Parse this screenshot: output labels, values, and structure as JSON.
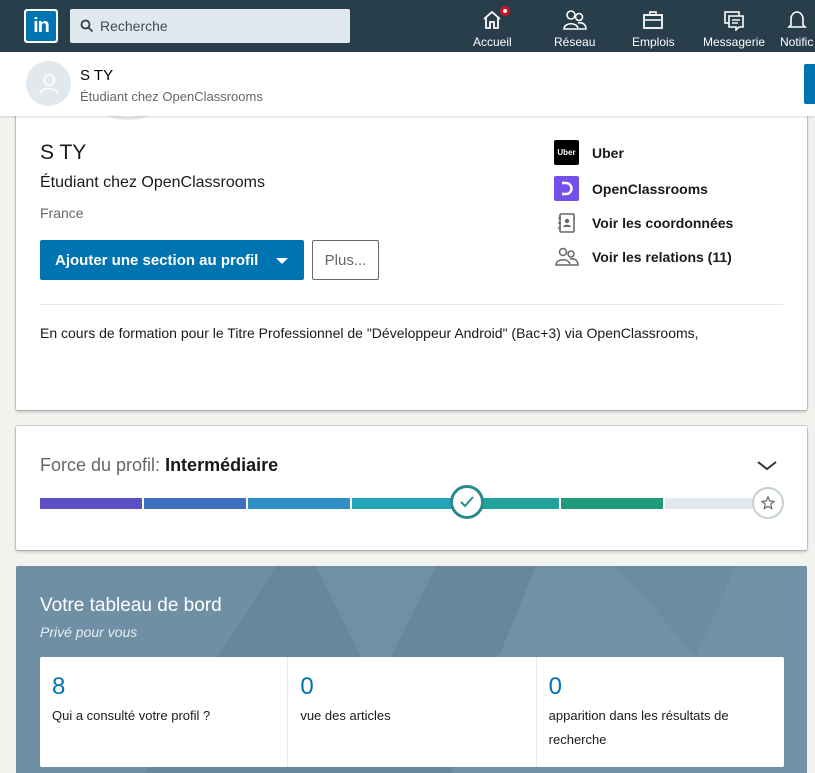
{
  "nav": {
    "logo_text": "in",
    "search_placeholder": "Recherche",
    "items": [
      {
        "label": "Accueil",
        "icon": "home-icon",
        "has_badge": true
      },
      {
        "label": "Réseau",
        "icon": "network-icon"
      },
      {
        "label": "Emplois",
        "icon": "briefcase-icon"
      },
      {
        "label": "Messagerie",
        "icon": "messaging-icon"
      },
      {
        "label": "Notific",
        "icon": "bell-icon"
      }
    ]
  },
  "sticky": {
    "name": "S TY",
    "headline": "Étudiant chez OpenClassrooms"
  },
  "profile": {
    "name": "S TY",
    "headline": "Étudiant chez OpenClassrooms",
    "location": "France",
    "add_section_label": "Ajouter une section au profil",
    "more_label": "Plus...",
    "right": {
      "company": "Uber",
      "company_logo_text": "Uber",
      "school": "OpenClassrooms",
      "contact": "Voir les coordonnées",
      "connections": "Voir les relations (11)"
    },
    "summary": "En cours de formation pour le Titre Professionnel de \"Développeur Android\" (Bac+3) via OpenClassrooms,"
  },
  "strength": {
    "label": "Force du profil: ",
    "level": "Intermédiaire",
    "progress_steps_completed": 6,
    "progress_steps_total": 7,
    "colors": [
      "#5b4fc4",
      "#3f6fbf",
      "#2f8fc7",
      "#23a6b8",
      "#21a29a",
      "#1f9a7a",
      "#1f8f4e",
      "#e1e9ee"
    ]
  },
  "dashboard": {
    "title": "Votre tableau de bord",
    "subtitle": "Privé pour vous",
    "stats": [
      {
        "value": "8",
        "label": "Qui a consulté votre profil ?"
      },
      {
        "value": "0",
        "label": "vue des articles"
      },
      {
        "value": "0",
        "label": "apparition dans les résultats de recherche"
      }
    ]
  },
  "colors": {
    "nav_bg": "#283e4a",
    "brand_blue": "#0073b1",
    "dashboard_bg": "#6a8a9f"
  }
}
